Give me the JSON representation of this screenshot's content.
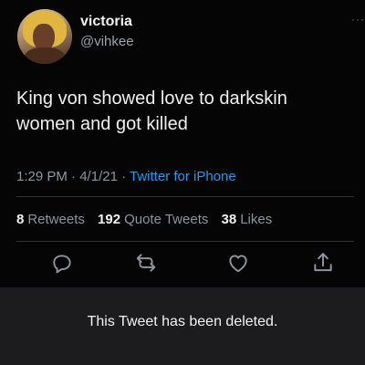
{
  "tweet": {
    "author": {
      "name": "victoria",
      "handle": "@vihkee"
    },
    "more_icon": "more-dots-icon",
    "text_lines": [
      "King von  showed love to darkskin",
      "women and got killed"
    ],
    "time": "1:29 PM",
    "date": "4/1/21",
    "separator": "·",
    "source": "Twitter for iPhone",
    "stats": {
      "retweets_count": "8",
      "retweets_label": "Retweets",
      "quote_count": "192",
      "quote_label": "Quote Tweets",
      "likes_count": "38",
      "likes_label": "Likes"
    },
    "actions": [
      "reply-icon",
      "retweet-icon",
      "like-icon",
      "share-icon"
    ]
  },
  "banner": {
    "message": "This Tweet has been deleted."
  },
  "colors": {
    "background": "#050505",
    "text": "#f0f0f0",
    "secondary": "#8c959d",
    "link": "#1d9bf0",
    "banner_bg": "#1c1c1e",
    "divider": "#2f3336"
  }
}
